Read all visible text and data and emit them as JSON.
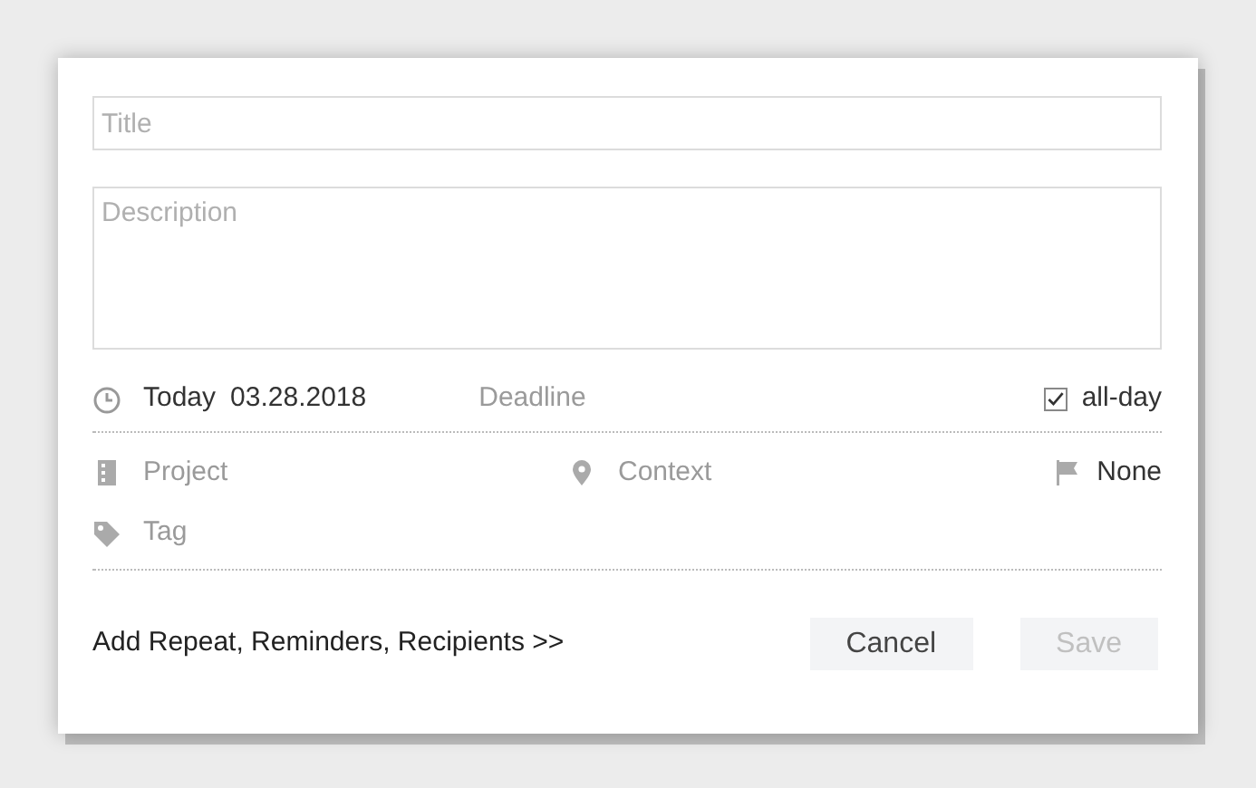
{
  "title_field": {
    "placeholder": "Title"
  },
  "description_field": {
    "placeholder": "Description"
  },
  "date": {
    "day": "Today",
    "date": "03.28.2018"
  },
  "deadline": {
    "placeholder": "Deadline"
  },
  "all_day": {
    "label": "all-day",
    "checked": true
  },
  "project": {
    "placeholder": "Project"
  },
  "context": {
    "placeholder": "Context"
  },
  "priority": {
    "label": "None"
  },
  "tag": {
    "placeholder": "Tag"
  },
  "more_link": "Add Repeat, Reminders, Recipients >>",
  "buttons": [
    {
      "label": "Cancel",
      "disabled": false
    },
    {
      "label": "Save",
      "disabled": true
    }
  ]
}
